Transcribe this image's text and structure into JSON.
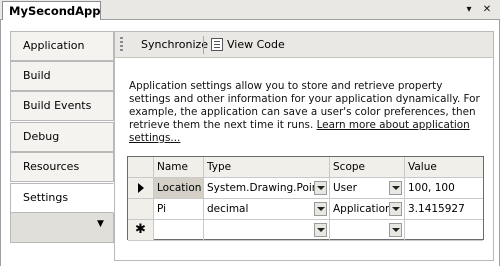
{
  "document_tab": {
    "title": "MySecondApp"
  },
  "window_controls": {
    "menu_glyph": "▾",
    "close_glyph": "✕"
  },
  "nav": {
    "items": [
      {
        "label": "Application"
      },
      {
        "label": "Build"
      },
      {
        "label": "Build Events"
      },
      {
        "label": "Debug"
      },
      {
        "label": "Resources"
      },
      {
        "label": "Settings",
        "active": true
      }
    ],
    "scroll_glyph": "▼"
  },
  "toolbar": {
    "synchronize": "Synchronize",
    "view_code": "View Code"
  },
  "description": {
    "text": "Application settings allow you to store and retrieve property settings and other information for your application dynamically. For example, the application can save a user's color preferences, then retrieve them the next time it runs. ",
    "link": "Learn more about application settings..."
  },
  "grid": {
    "columns": [
      "Name",
      "Type",
      "Scope",
      "Value"
    ],
    "rows": [
      {
        "indicator": "▶",
        "name": "Location",
        "type": "System.Drawing.Point",
        "scope": "User",
        "value": "100, 100"
      },
      {
        "indicator": "",
        "name": "Pi",
        "type": "decimal",
        "scope": "Application",
        "value": "3.1415927"
      },
      {
        "indicator": "✱",
        "name": "",
        "type": "",
        "scope": "",
        "value": ""
      }
    ]
  }
}
